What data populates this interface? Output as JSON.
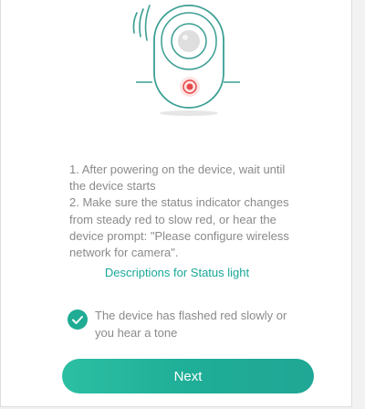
{
  "instructions": {
    "step1_line1": "1. After powering on the device, wait until",
    "step1_line2": "the device starts",
    "step2_line1": "2. Make sure the status indicator changes",
    "step2_line2": "from steady red to slow red, or hear the",
    "step2_line3": "device prompt: \"Please configure wireless",
    "step2_line4": "network for camera\"."
  },
  "status_link": "Descriptions for Status light",
  "confirmation": {
    "checked": true,
    "line1": "The device has flashed red slowly or",
    "line2": "you hear a tone"
  },
  "next_button": "Next",
  "colors": {
    "accent": "#1fab94",
    "link": "#1aa898",
    "text": "#8a8a8a",
    "indicator": "#e84a4a"
  }
}
